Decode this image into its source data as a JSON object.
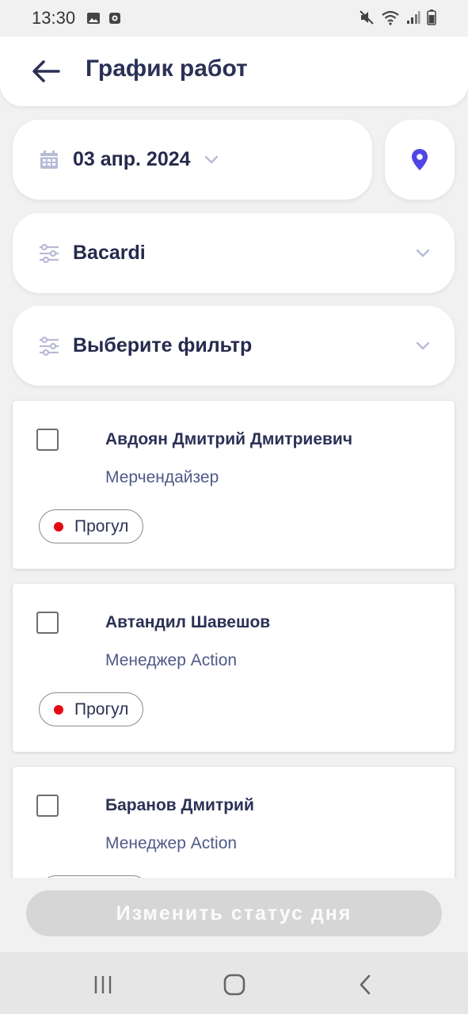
{
  "status_bar": {
    "time": "13:30"
  },
  "header": {
    "title": "График работ",
    "back_icon": "arrow-left-icon"
  },
  "date_selector": {
    "value": "03 апр. 2024",
    "icon": "calendar-icon"
  },
  "location_button": {
    "icon": "location-pin-icon",
    "color": "#5046e5"
  },
  "filters": [
    {
      "value": "Bacardi",
      "icon": "sliders-icon"
    },
    {
      "value": "Выберите фильтр",
      "icon": "sliders-icon"
    }
  ],
  "employees": [
    {
      "name": "Авдоян Дмитрий Дмитриевич",
      "role": "Мерчендайзер",
      "status": "Прогул",
      "checked": false
    },
    {
      "name": "Автандил Шавешов",
      "role": "Менеджер Action",
      "status": "Прогул",
      "checked": false
    },
    {
      "name": "Баранов Дмитрий",
      "role": "Менеджер Action",
      "status": "",
      "checked": false
    }
  ],
  "actions": {
    "change_status_label": "Изменить статус дня"
  },
  "colors": {
    "status_red": "#e50914",
    "title_navy": "#2b3156",
    "accent": "#5046e5"
  }
}
